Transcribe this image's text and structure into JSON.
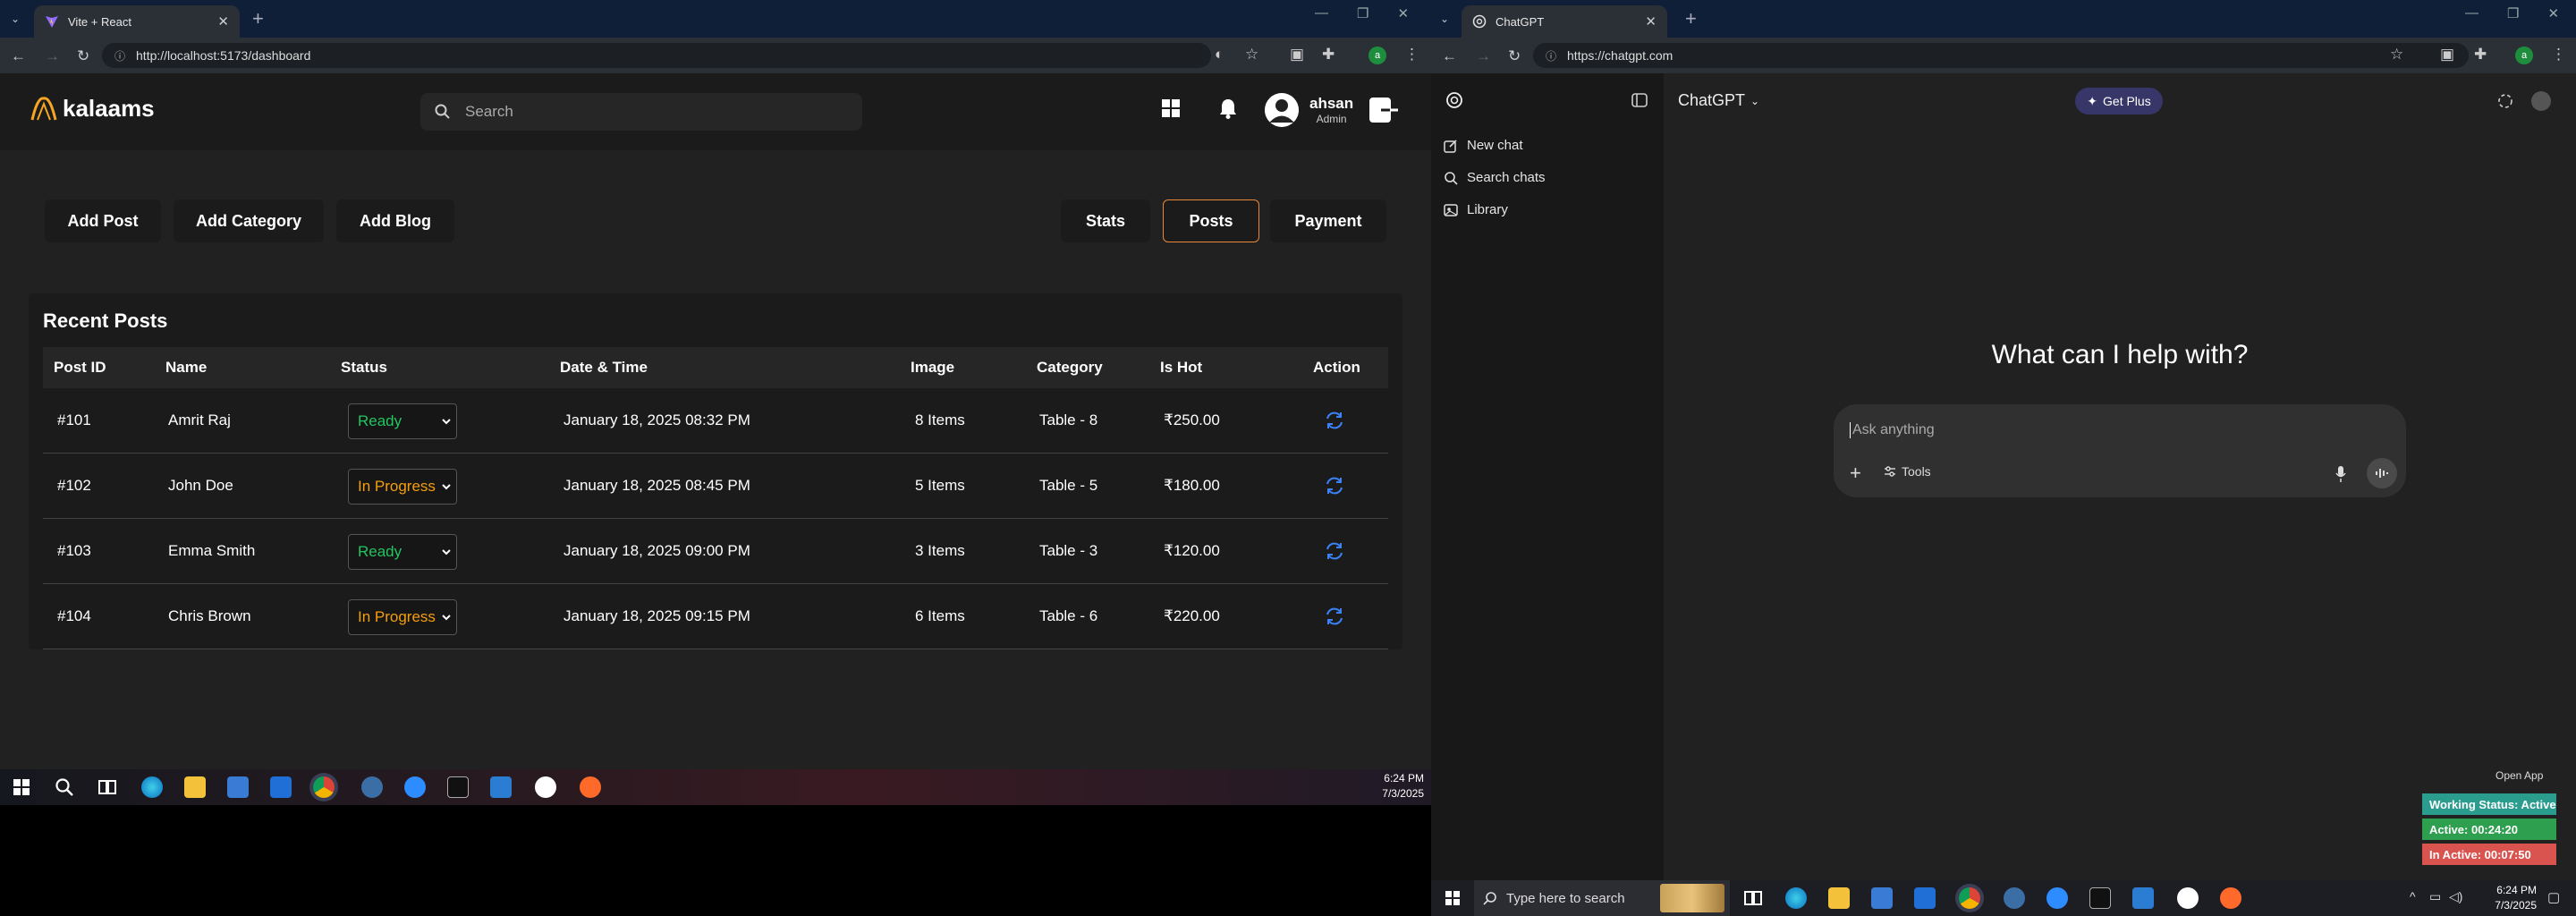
{
  "left_browser": {
    "tab_title": "Vite + React",
    "url": "http://localhost:5173/dashboard",
    "profile_initial": "a"
  },
  "app": {
    "logo_text": "kalaams",
    "search_placeholder": "Search",
    "user_name": "ahsan",
    "user_role": "Admin",
    "left_buttons": [
      "Add Post",
      "Add Category",
      "Add Blog"
    ],
    "right_buttons": [
      "Stats",
      "Posts",
      "Payment"
    ],
    "active_button": "Posts",
    "table_title": "Recent Posts",
    "columns": [
      "Post ID",
      "Name",
      "Status",
      "Date & Time",
      "Image",
      "Category",
      "Is Hot",
      "Action"
    ],
    "rows": [
      {
        "id": "#101",
        "name": "Amrit Raj",
        "status": "Ready",
        "date": "January 18, 2025 08:32 PM",
        "image": "8 Items",
        "category": "Table - 8",
        "hot": "₹250.00"
      },
      {
        "id": "#102",
        "name": "John Doe",
        "status": "In Progress",
        "date": "January 18, 2025 08:45 PM",
        "image": "5 Items",
        "category": "Table - 5",
        "hot": "₹180.00"
      },
      {
        "id": "#103",
        "name": "Emma Smith",
        "status": "Ready",
        "date": "January 18, 2025 09:00 PM",
        "image": "3 Items",
        "category": "Table - 3",
        "hot": "₹120.00"
      },
      {
        "id": "#104",
        "name": "Chris Brown",
        "status": "In Progress",
        "date": "January 18, 2025 09:15 PM",
        "image": "6 Items",
        "category": "Table - 6",
        "hot": "₹220.00"
      }
    ],
    "colors": {
      "ready": "#22c55e",
      "in_progress": "#f59e0b",
      "action": "#3b82f6",
      "active_border": "#e8883a"
    }
  },
  "left_taskbar": {
    "time": "6:24 PM",
    "date": "7/3/2025"
  },
  "right_browser": {
    "tab_title": "ChatGPT",
    "url": "https://chatgpt.com",
    "profile_initial": "a"
  },
  "chatgpt": {
    "sidebar_items": [
      "New chat",
      "Search chats",
      "Library"
    ],
    "model_label": "ChatGPT",
    "get_plus": "Get Plus",
    "hero": "What can I help with?",
    "input_placeholder": "Ask anything",
    "tools_label": "Tools"
  },
  "status_widget": {
    "open_app": "Open App",
    "working_status": "Working Status: Active",
    "active_time": "Active: 00:24:20",
    "inactive_time": "In Active: 00:07:50",
    "colors": {
      "working": "#2a9d8f",
      "active": "#2e9e4f",
      "inactive": "#d9534f"
    }
  },
  "right_taskbar": {
    "search_placeholder": "Type here to search",
    "time": "6:24 PM",
    "date": "7/3/2025"
  }
}
